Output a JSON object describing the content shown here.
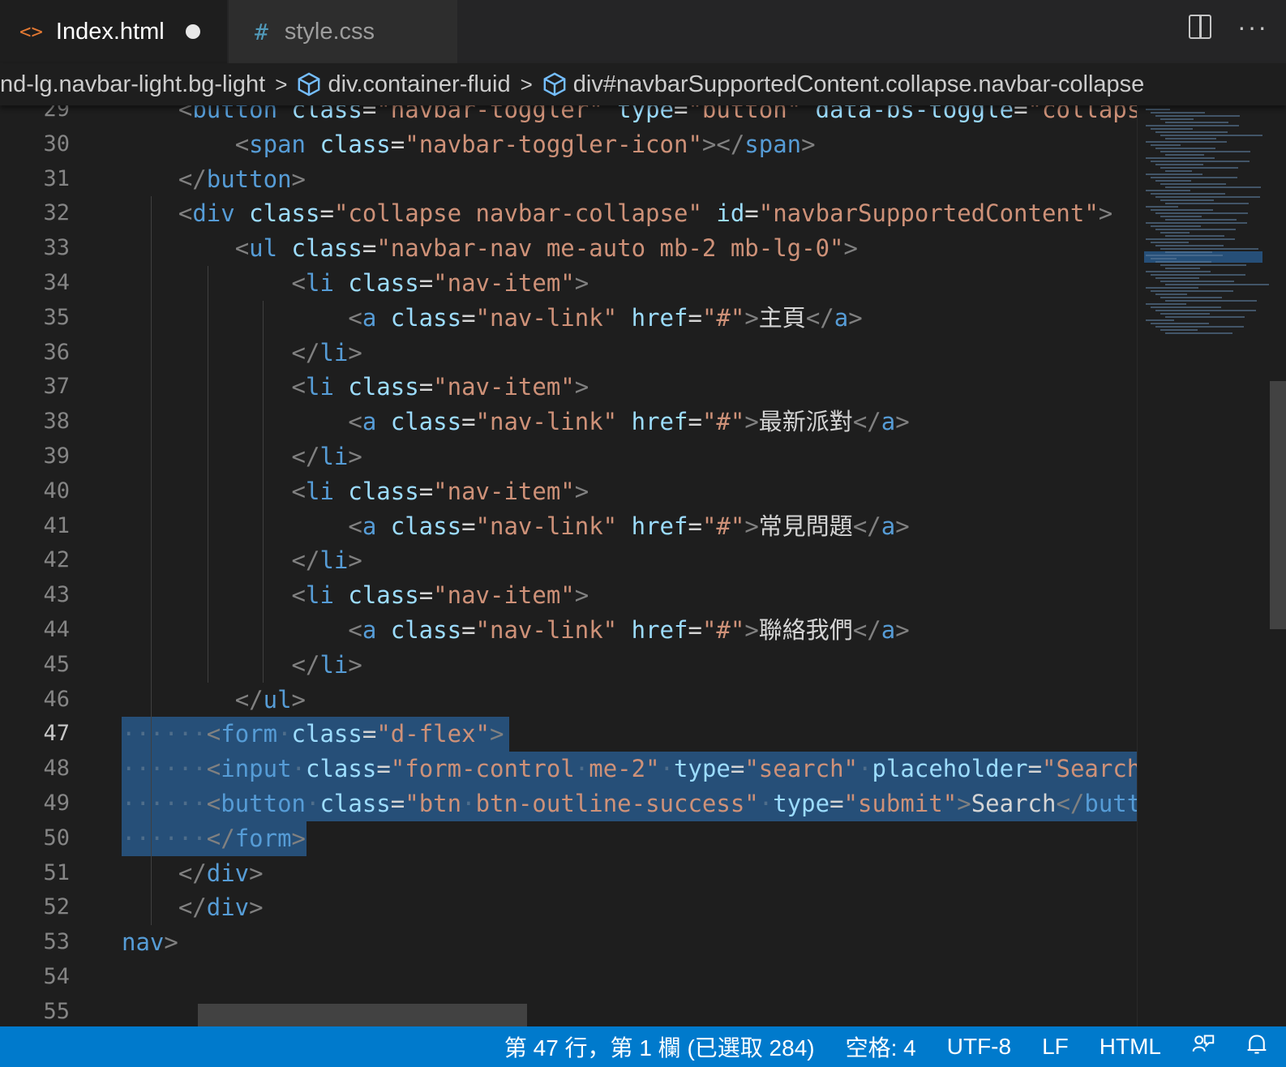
{
  "tabs": [
    {
      "label": "Index.html",
      "icon": "html-file-icon",
      "dirty": true
    },
    {
      "label": "style.css",
      "icon": "css-file-icon",
      "dirty": false
    }
  ],
  "breadcrumb": [
    "nd-lg.navbar-light.bg-light",
    "div.container-fluid",
    "div#navbarSupportedContent.collapse.navbar-collapse"
  ],
  "lines": [
    {
      "n": "29",
      "segs": [
        [
          "t",
          "    <"
        ],
        [
          "tg",
          "button"
        ],
        [
          "x",
          " "
        ],
        [
          "at",
          "class"
        ],
        [
          "x",
          "="
        ],
        [
          "v",
          "\"navbar-toggler\""
        ],
        [
          "x",
          " "
        ],
        [
          "at",
          "type"
        ],
        [
          "x",
          "="
        ],
        [
          "v",
          "\"button\""
        ],
        [
          "x",
          " "
        ],
        [
          "at",
          "data-bs-toggle"
        ],
        [
          "x",
          "="
        ],
        [
          "v",
          "\"collapse\""
        ]
      ]
    },
    {
      "n": "30",
      "segs": [
        [
          "x",
          "        "
        ],
        [
          "t",
          "<"
        ],
        [
          "tg",
          "span"
        ],
        [
          "x",
          " "
        ],
        [
          "at",
          "class"
        ],
        [
          "x",
          "="
        ],
        [
          "v",
          "\"navbar-toggler-icon\""
        ],
        [
          "t",
          "></"
        ],
        [
          "tg",
          "span"
        ],
        [
          "t",
          ">"
        ]
      ]
    },
    {
      "n": "31",
      "segs": [
        [
          "x",
          "    "
        ],
        [
          "t",
          "</"
        ],
        [
          "tg",
          "button"
        ],
        [
          "t",
          ">"
        ]
      ]
    },
    {
      "n": "32",
      "segs": [
        [
          "x",
          "    "
        ],
        [
          "t",
          "<"
        ],
        [
          "tg",
          "div"
        ],
        [
          "x",
          " "
        ],
        [
          "at",
          "class"
        ],
        [
          "x",
          "="
        ],
        [
          "v",
          "\"collapse navbar-collapse\""
        ],
        [
          "x",
          " "
        ],
        [
          "at",
          "id"
        ],
        [
          "x",
          "="
        ],
        [
          "v",
          "\"navbarSupportedContent\""
        ],
        [
          "t",
          ">"
        ]
      ]
    },
    {
      "n": "33",
      "segs": [
        [
          "x",
          "        "
        ],
        [
          "t",
          "<"
        ],
        [
          "tg",
          "ul"
        ],
        [
          "x",
          " "
        ],
        [
          "at",
          "class"
        ],
        [
          "x",
          "="
        ],
        [
          "v",
          "\"navbar-nav me-auto mb-2 mb-lg-0\""
        ],
        [
          "t",
          ">"
        ]
      ]
    },
    {
      "n": "34",
      "segs": [
        [
          "x",
          "            "
        ],
        [
          "t",
          "<"
        ],
        [
          "tg",
          "li"
        ],
        [
          "x",
          " "
        ],
        [
          "at",
          "class"
        ],
        [
          "x",
          "="
        ],
        [
          "v",
          "\"nav-item\""
        ],
        [
          "t",
          ">"
        ]
      ]
    },
    {
      "n": "35",
      "segs": [
        [
          "x",
          "                "
        ],
        [
          "t",
          "<"
        ],
        [
          "tg",
          "a"
        ],
        [
          "x",
          " "
        ],
        [
          "at",
          "class"
        ],
        [
          "x",
          "="
        ],
        [
          "v",
          "\"nav-link\""
        ],
        [
          "x",
          " "
        ],
        [
          "at",
          "href"
        ],
        [
          "x",
          "="
        ],
        [
          "v",
          "\"#\""
        ],
        [
          "t",
          ">"
        ],
        [
          "x",
          "主頁"
        ],
        [
          "t",
          "</"
        ],
        [
          "tg",
          "a"
        ],
        [
          "t",
          ">"
        ]
      ]
    },
    {
      "n": "36",
      "segs": [
        [
          "x",
          "            "
        ],
        [
          "t",
          "</"
        ],
        [
          "tg",
          "li"
        ],
        [
          "t",
          ">"
        ]
      ]
    },
    {
      "n": "37",
      "segs": [
        [
          "x",
          "            "
        ],
        [
          "t",
          "<"
        ],
        [
          "tg",
          "li"
        ],
        [
          "x",
          " "
        ],
        [
          "at",
          "class"
        ],
        [
          "x",
          "="
        ],
        [
          "v",
          "\"nav-item\""
        ],
        [
          "t",
          ">"
        ]
      ]
    },
    {
      "n": "38",
      "segs": [
        [
          "x",
          "                "
        ],
        [
          "t",
          "<"
        ],
        [
          "tg",
          "a"
        ],
        [
          "x",
          " "
        ],
        [
          "at",
          "class"
        ],
        [
          "x",
          "="
        ],
        [
          "v",
          "\"nav-link\""
        ],
        [
          "x",
          " "
        ],
        [
          "at",
          "href"
        ],
        [
          "x",
          "="
        ],
        [
          "v",
          "\"#\""
        ],
        [
          "t",
          ">"
        ],
        [
          "x",
          "最新派對"
        ],
        [
          "t",
          "</"
        ],
        [
          "tg",
          "a"
        ],
        [
          "t",
          ">"
        ]
      ]
    },
    {
      "n": "39",
      "segs": [
        [
          "x",
          "            "
        ],
        [
          "t",
          "</"
        ],
        [
          "tg",
          "li"
        ],
        [
          "t",
          ">"
        ]
      ]
    },
    {
      "n": "40",
      "segs": [
        [
          "x",
          "            "
        ],
        [
          "t",
          "<"
        ],
        [
          "tg",
          "li"
        ],
        [
          "x",
          " "
        ],
        [
          "at",
          "class"
        ],
        [
          "x",
          "="
        ],
        [
          "v",
          "\"nav-item\""
        ],
        [
          "t",
          ">"
        ]
      ]
    },
    {
      "n": "41",
      "segs": [
        [
          "x",
          "                "
        ],
        [
          "t",
          "<"
        ],
        [
          "tg",
          "a"
        ],
        [
          "x",
          " "
        ],
        [
          "at",
          "class"
        ],
        [
          "x",
          "="
        ],
        [
          "v",
          "\"nav-link\""
        ],
        [
          "x",
          " "
        ],
        [
          "at",
          "href"
        ],
        [
          "x",
          "="
        ],
        [
          "v",
          "\"#\""
        ],
        [
          "t",
          ">"
        ],
        [
          "x",
          "常見問題"
        ],
        [
          "t",
          "</"
        ],
        [
          "tg",
          "a"
        ],
        [
          "t",
          ">"
        ]
      ]
    },
    {
      "n": "42",
      "segs": [
        [
          "x",
          "            "
        ],
        [
          "t",
          "</"
        ],
        [
          "tg",
          "li"
        ],
        [
          "t",
          ">"
        ]
      ]
    },
    {
      "n": "43",
      "segs": [
        [
          "x",
          "            "
        ],
        [
          "t",
          "<"
        ],
        [
          "tg",
          "li"
        ],
        [
          "x",
          " "
        ],
        [
          "at",
          "class"
        ],
        [
          "x",
          "="
        ],
        [
          "v",
          "\"nav-item\""
        ],
        [
          "t",
          ">"
        ]
      ]
    },
    {
      "n": "44",
      "segs": [
        [
          "x",
          "                "
        ],
        [
          "t",
          "<"
        ],
        [
          "tg",
          "a"
        ],
        [
          "x",
          " "
        ],
        [
          "at",
          "class"
        ],
        [
          "x",
          "="
        ],
        [
          "v",
          "\"nav-link\""
        ],
        [
          "x",
          " "
        ],
        [
          "at",
          "href"
        ],
        [
          "x",
          "="
        ],
        [
          "v",
          "\"#\""
        ],
        [
          "t",
          ">"
        ],
        [
          "x",
          "聯絡我們"
        ],
        [
          "t",
          "</"
        ],
        [
          "tg",
          "a"
        ],
        [
          "t",
          ">"
        ]
      ]
    },
    {
      "n": "45",
      "segs": [
        [
          "x",
          "            "
        ],
        [
          "t",
          "</"
        ],
        [
          "tg",
          "li"
        ],
        [
          "t",
          ">"
        ]
      ]
    },
    {
      "n": "46",
      "segs": [
        [
          "x",
          "        "
        ],
        [
          "t",
          "</"
        ],
        [
          "tg",
          "ul"
        ],
        [
          "t",
          ">"
        ]
      ]
    },
    {
      "n": "47",
      "segs": [
        [
          "ws",
          "······"
        ],
        [
          "t",
          "<"
        ],
        [
          "tg",
          "form"
        ],
        [
          "ws",
          "·"
        ],
        [
          "at",
          "class"
        ],
        [
          "x",
          "="
        ],
        [
          "v",
          "\"d-flex\""
        ],
        [
          "t",
          ">"
        ]
      ],
      "sel": true
    },
    {
      "n": "48",
      "segs": [
        [
          "ws",
          "······"
        ],
        [
          "t",
          "<"
        ],
        [
          "tg",
          "input"
        ],
        [
          "ws",
          "·"
        ],
        [
          "at",
          "class"
        ],
        [
          "x",
          "="
        ],
        [
          "v",
          "\"form-control"
        ],
        [
          "ws",
          "·"
        ],
        [
          "v",
          "me-2\""
        ],
        [
          "ws",
          "·"
        ],
        [
          "at",
          "type"
        ],
        [
          "x",
          "="
        ],
        [
          "v",
          "\"search\""
        ],
        [
          "ws",
          "·"
        ],
        [
          "at",
          "placeholder"
        ],
        [
          "x",
          "="
        ],
        [
          "v",
          "\"Search"
        ]
      ],
      "sel": true
    },
    {
      "n": "49",
      "segs": [
        [
          "ws",
          "······"
        ],
        [
          "t",
          "<"
        ],
        [
          "tg",
          "button"
        ],
        [
          "ws",
          "·"
        ],
        [
          "at",
          "class"
        ],
        [
          "x",
          "="
        ],
        [
          "v",
          "\"btn"
        ],
        [
          "ws",
          "·"
        ],
        [
          "v",
          "btn-outline-success\""
        ],
        [
          "ws",
          "·"
        ],
        [
          "at",
          "type"
        ],
        [
          "x",
          "="
        ],
        [
          "v",
          "\"submit\""
        ],
        [
          "t",
          ">"
        ],
        [
          "x",
          "Search"
        ],
        [
          "t",
          "</"
        ],
        [
          "tg",
          "butt"
        ]
      ],
      "sel": true
    },
    {
      "n": "50",
      "segs": [
        [
          "ws",
          "······"
        ],
        [
          "t",
          "</"
        ],
        [
          "tg",
          "form"
        ],
        [
          "t",
          ">"
        ]
      ],
      "sel": true
    },
    {
      "n": "51",
      "segs": [
        [
          "x",
          "    "
        ],
        [
          "t",
          "</"
        ],
        [
          "tg",
          "div"
        ],
        [
          "t",
          ">"
        ]
      ]
    },
    {
      "n": "52",
      "segs": [
        [
          "x",
          "    "
        ],
        [
          "t",
          "</"
        ],
        [
          "tg",
          "div"
        ],
        [
          "t",
          ">"
        ]
      ]
    },
    {
      "n": "53",
      "segs": [
        [
          "tg",
          "nav"
        ],
        [
          "t",
          ">"
        ]
      ]
    },
    {
      "n": "54",
      "segs": []
    },
    {
      "n": "55",
      "segs": []
    }
  ],
  "status": {
    "position": "第 47 行，第 1 欄 (已選取 284)",
    "indent": "空格: 4",
    "encoding": "UTF-8",
    "eol": "LF",
    "language": "HTML"
  }
}
